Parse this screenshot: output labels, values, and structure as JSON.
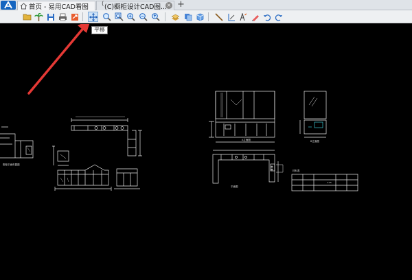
{
  "app": {
    "logo_letter": "A"
  },
  "tabs": [
    {
      "label": "首页 - 易用CAD看图"
    },
    {
      "label": "(C)橱柜设计CAD图..."
    }
  ],
  "tab_marker": "(",
  "tab_add_label": "+",
  "tab_close_glyph": "×",
  "toolbar": {
    "icons": [
      "open-folder-icon",
      "palm-tree-icon",
      "save-icon",
      "print-icon",
      "export-icon",
      "pan-icon",
      "zoom-window-icon",
      "zoom-extents-icon",
      "zoom-in-icon",
      "zoom-out-icon",
      "zoom-realtime-icon",
      "layer-icon",
      "layout-icon",
      "3d-box-icon",
      "measure-line-icon",
      "measure-coord-icon",
      "text-icon",
      "markup-icon",
      "undo-icon",
      "redo-icon"
    ],
    "active_tool": "pan",
    "tooltip": "平移"
  },
  "drawing": {
    "labels": {
      "plan_left": "橱柜平面布置图",
      "elev_1": "A立面图",
      "elev_2": "B立面图",
      "plan_main": "平面图",
      "table_title": "材料表",
      "table_cell": "1:25"
    }
  },
  "colors": {
    "accent": "#1565c0",
    "arrow": "#e53935",
    "canvas": "#000000",
    "lines": "#e8e8e8"
  }
}
